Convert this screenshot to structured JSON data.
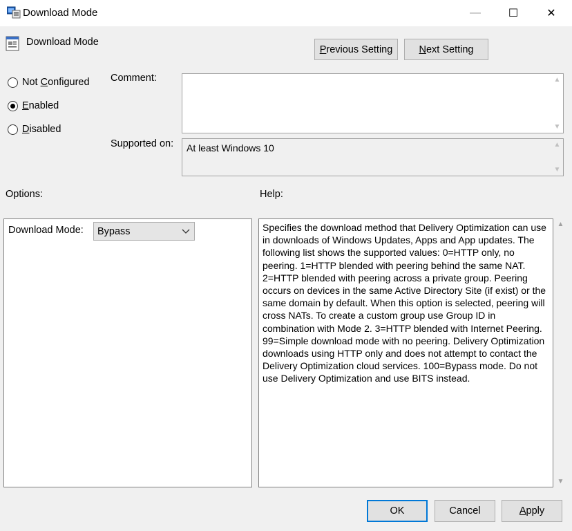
{
  "window": {
    "title": "Download Mode",
    "controls": {
      "minimize": "—",
      "maximize": "☐",
      "close": "✕"
    }
  },
  "header": {
    "setting_name": "Download Mode",
    "previous_prefix": "P",
    "previous_rest": "revious Setting",
    "next_prefix": "N",
    "next_rest": "ext Setting"
  },
  "state": {
    "options": [
      {
        "pre": "Not ",
        "key": "C",
        "post": "onfigured",
        "checked": false
      },
      {
        "pre": "",
        "key": "E",
        "post": "nabled",
        "checked": true
      },
      {
        "pre": "",
        "key": "D",
        "post": "isabled",
        "checked": false
      }
    ]
  },
  "comment": {
    "label": "Comment:",
    "value": ""
  },
  "supported": {
    "label": "Supported on:",
    "value": "At least Windows 10"
  },
  "options_section": {
    "label": "Options:",
    "download_mode_label": "Download Mode:",
    "download_mode_value": "Bypass"
  },
  "help": {
    "label": "Help:",
    "text": "Specifies the download method that Delivery Optimization can use in downloads of Windows Updates, Apps and App updates. The following list shows the supported values: 0=HTTP only, no peering. 1=HTTP blended with peering behind the same NAT. 2=HTTP blended with peering across a private group. Peering occurs on devices in the same Active Directory Site (if exist) or the same domain by default. When this option is selected, peering will cross NATs. To create a custom group use Group ID in combination with Mode 2. 3=HTTP blended with Internet Peering. 99=Simple download mode with no peering. Delivery Optimization downloads using HTTP only and does not attempt to contact the Delivery Optimization cloud services. 100=Bypass mode. Do not use Delivery Optimization and use BITS instead."
  },
  "footer": {
    "ok": "OK",
    "cancel": "Cancel",
    "apply_prefix": "A",
    "apply_rest": "pply"
  },
  "colors": {
    "focus_border": "#0078d7",
    "button_bg": "#e1e1e1",
    "dialog_bg": "#f0f0f0"
  }
}
